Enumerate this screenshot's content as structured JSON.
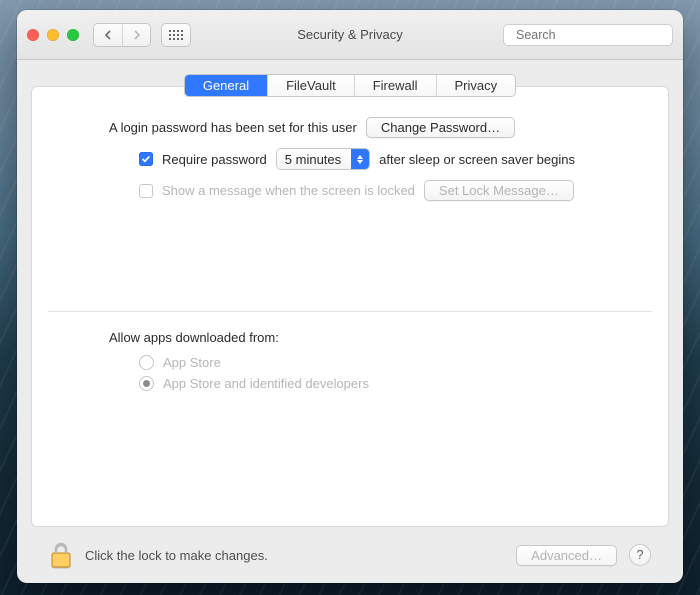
{
  "window": {
    "title": "Security & Privacy"
  },
  "search": {
    "placeholder": "Search",
    "value": ""
  },
  "tabs": {
    "items": [
      "General",
      "FileVault",
      "Firewall",
      "Privacy"
    ],
    "active_index": 0
  },
  "general": {
    "login_password_text": "A login password has been set for this user",
    "change_password_button": "Change Password…",
    "require_password": {
      "checked": true,
      "label_before": "Require password",
      "delay_value": "5 minutes",
      "label_after": "after sleep or screen saver begins"
    },
    "lock_message": {
      "checked": false,
      "label": "Show a message when the screen is locked",
      "button": "Set Lock Message…"
    },
    "gatekeeper": {
      "section_label": "Allow apps downloaded from:",
      "options": [
        "App Store",
        "App Store and identified developers"
      ],
      "selected_index": 1,
      "locked": true
    }
  },
  "footer": {
    "lock_hint": "Click the lock to make changes.",
    "advanced_button": "Advanced…",
    "help": "?"
  }
}
